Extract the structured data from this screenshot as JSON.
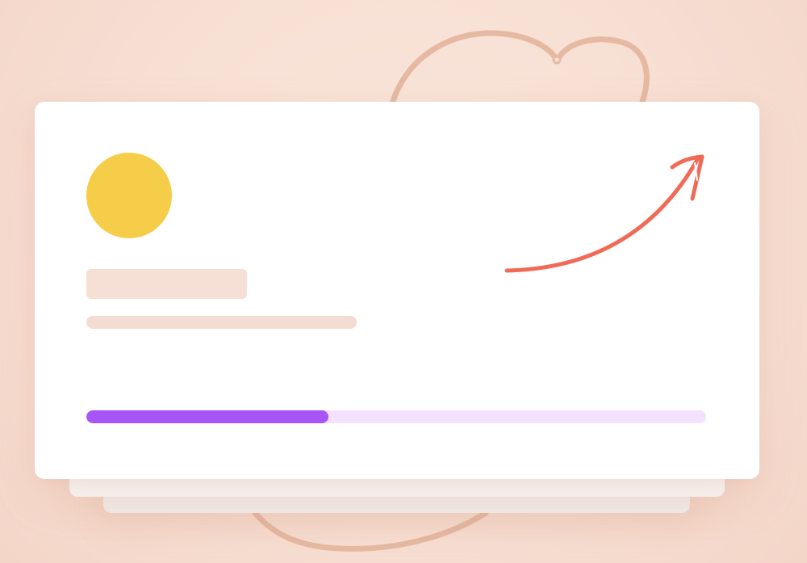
{
  "illustration": {
    "background_color": "#f8e3d8",
    "card_color": "#ffffff",
    "sun_color": "#f6cd48",
    "placeholder_color": "#f6dfd4",
    "arrow_color": "#ef6b57",
    "squiggle_color": "#e5b9a2",
    "progress": {
      "track_color": "#f4e1fd",
      "fill_color": "#a855f7",
      "value_fraction": 0.39
    },
    "icons": {
      "sun": "sun-icon",
      "arrow": "trend-arrow-icon",
      "decorative_scribble": "scribble-heart-icon"
    }
  }
}
